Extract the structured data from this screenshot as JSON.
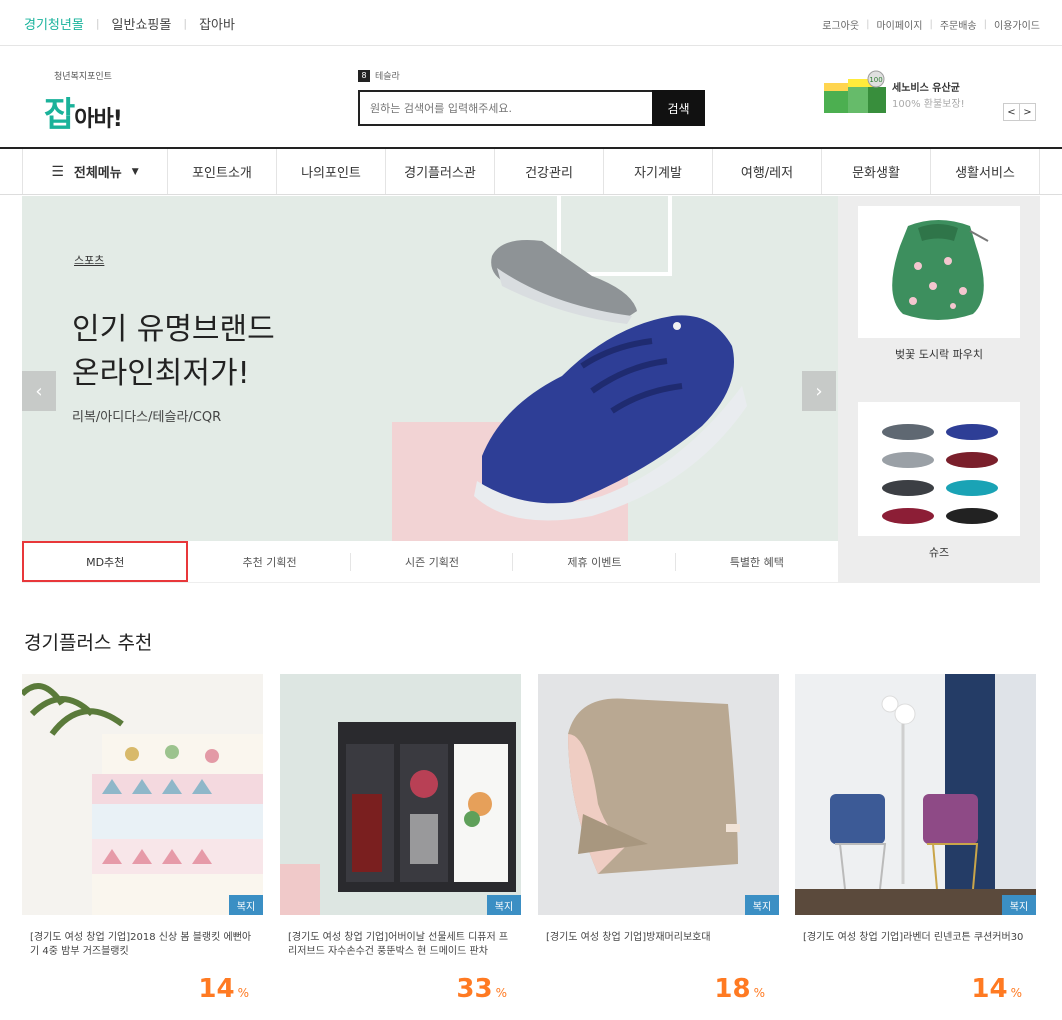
{
  "topbar": {
    "malls": [
      {
        "label": "경기청년몰",
        "active": true
      },
      {
        "label": "일반쇼핑몰",
        "active": false
      },
      {
        "label": "잡아바",
        "active": false
      }
    ],
    "util": [
      "로그아웃",
      "마이페이지",
      "주문배송",
      "이용가이드"
    ]
  },
  "header": {
    "logo_sub": "청년복지포인트",
    "logo_main": "잡",
    "logo_rest": "아바!",
    "search": {
      "rank_num": "8",
      "rank_term": "테슬라",
      "placeholder": "원하는 검색어를 입력해주세요.",
      "button": "검색"
    },
    "promo": {
      "title": "세노비스 유산균",
      "subtitle": "100% 환불보장!"
    },
    "prev": "<",
    "next": ">"
  },
  "nav": {
    "all_label": "전체메뉴",
    "items": [
      "포인트소개",
      "나의포인트",
      "경기플러스관",
      "건강관리",
      "자기계발",
      "여행/레저",
      "문화생활",
      "생활서비스"
    ]
  },
  "hero": {
    "category": "스포츠",
    "headline_1": "인기 유명브랜드",
    "headline_2": "온라인최저가!",
    "brands": "리복/아디다스/테슬라/CQR",
    "tabs": [
      "MD추천",
      "추천 기획전",
      "시즌 기획전",
      "제휴 이벤트",
      "특별한 혜택"
    ],
    "active_tab": 0
  },
  "side": [
    {
      "caption": "벚꽃 도시락 파우치"
    },
    {
      "caption": "슈즈"
    }
  ],
  "recommend": {
    "title": "경기플러스 추천",
    "badge": "복지",
    "percent_sign": "%",
    "products": [
      {
        "name": "[경기도 여성 창업 기업]2018 신상 봄 블랭킷 에뻔아기 4중 밤부 거즈블랭킷",
        "discount": "14"
      },
      {
        "name": "[경기도 여성 창업 기업]어버이날 선물세트 디퓨저 프리저브드 자수손수건 풍뚠박스 현 드메이드 판차",
        "discount": "33"
      },
      {
        "name": "[경기도 여성 창업 기업]방재머리보호대",
        "discount": "18"
      },
      {
        "name": "[경기도 여성 창업 기업]라벤더 린넨코튼 쿠션커버30",
        "discount": "14"
      }
    ]
  },
  "colors": {
    "accent": "#19b39c",
    "discount": "#ff7a22",
    "badge": "#3b8fc4",
    "active_tab_border": "#e8373a"
  }
}
